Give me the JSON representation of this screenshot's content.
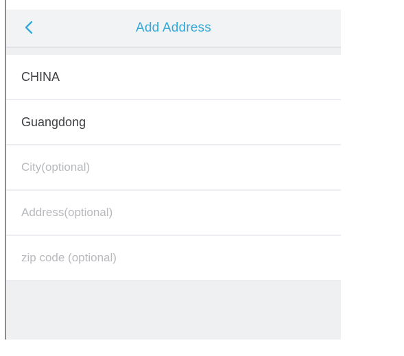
{
  "header": {
    "title": "Add Address",
    "back_icon": "chevron-left-icon",
    "accent_color": "#36a8d8"
  },
  "form": {
    "country": "CHINA",
    "province": "Guangdong",
    "city_placeholder": "City(optional)",
    "address_placeholder": "Address(optional)",
    "zip_placeholder": "zip code (optional)"
  }
}
